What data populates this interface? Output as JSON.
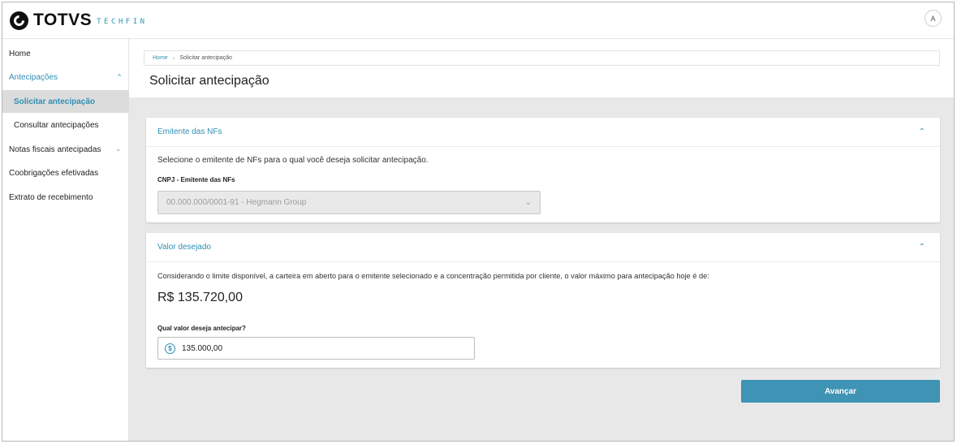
{
  "brand": {
    "name": "TOTVS",
    "sub": "TECHFIN"
  },
  "header": {
    "user_icon": "user-icon",
    "user_glyph": "A"
  },
  "sidebar": {
    "items": [
      {
        "label": "Home"
      },
      {
        "label": "Antecipações"
      },
      {
        "label": "Solicitar antecipação"
      },
      {
        "label": "Consultar antecipações"
      },
      {
        "label": "Notas fiscais antecipadas"
      },
      {
        "label": "Coobrigações efetivadas"
      },
      {
        "label": "Extrato de recebimento"
      }
    ],
    "chevrons": {
      "up": "^",
      "down": "⌄"
    }
  },
  "breadcrumb": {
    "home": "Home",
    "current": "Solicitar antecipação"
  },
  "page": {
    "title": "Solicitar antecipação"
  },
  "issuer_card": {
    "title": "Emitente das NFs",
    "description": "Selecione o emitente de NFs para o qual você deseja solicitar antecipação.",
    "field_label": "CNPJ - Emitente das NFs",
    "selected_value": "00.000.000/0001-91 - Hegmann Group"
  },
  "value_card": {
    "title": "Valor desejado",
    "description": "Considerando o limite disponível, a carteira em aberto para o emitente selecionado e a concentração permitida por cliente, o valor máximo para antecipação hoje é de:",
    "max_value": "R$ 135.720,00",
    "field_label": "Qual valor deseja antecipar?",
    "input_value": "135.000,00",
    "currency_glyph": "$"
  },
  "actions": {
    "next_label": "Avançar"
  },
  "colors": {
    "accent": "#2f8fb4",
    "button": "#3f93b4",
    "background": "#e8e8e8"
  }
}
